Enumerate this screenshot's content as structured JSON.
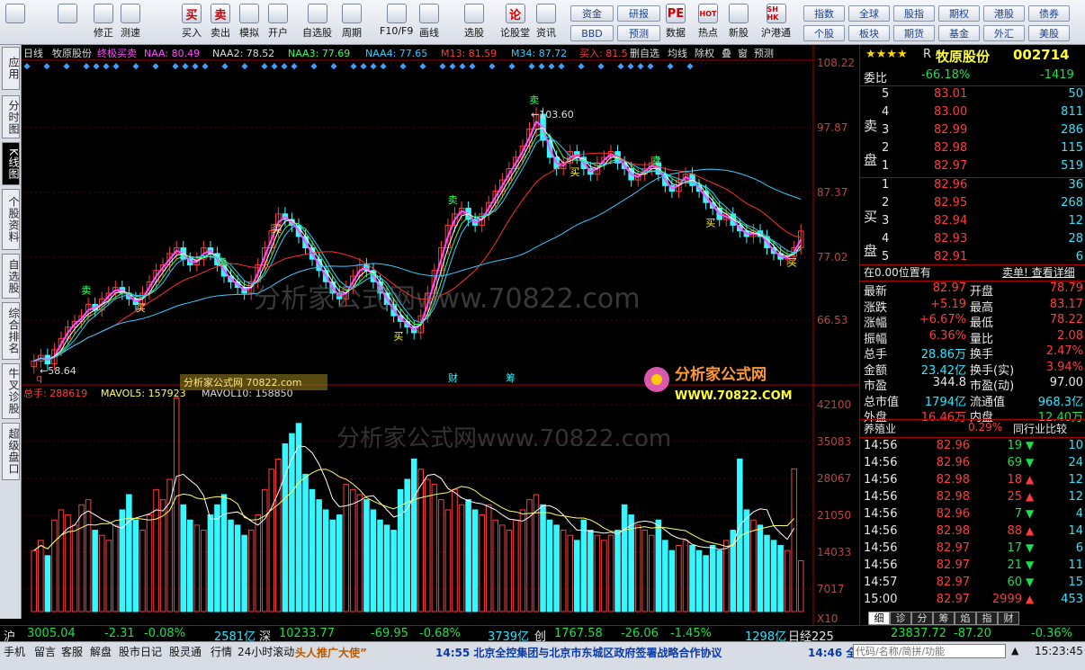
{
  "toolbar": {
    "buttons": [
      {
        "label": "",
        "icon": "app-logo-icon"
      },
      {
        "label": "",
        "icon": "back-arrow-icon"
      },
      {
        "label": "修正",
        "icon": "up-down-icon"
      },
      {
        "label": "测速",
        "icon": "speed-test-icon"
      },
      {
        "label": "买入",
        "icon": "buy-icon",
        "glyph": "买"
      },
      {
        "label": "卖出",
        "icon": "sell-icon",
        "glyph": "卖"
      },
      {
        "label": "模拟",
        "icon": "hammer-icon"
      },
      {
        "label": "开户",
        "icon": "lock-icon"
      },
      {
        "label": "自选股",
        "icon": "star-icon"
      },
      {
        "label": "周期",
        "icon": "clock-icon"
      },
      {
        "label": "F10/F9",
        "icon": "f10-icon"
      },
      {
        "label": "画线",
        "icon": "pen-icon"
      },
      {
        "label": "选股",
        "icon": "select-stock-icon"
      },
      {
        "label": "论股堂",
        "icon": "forum-icon",
        "glyph": "论"
      },
      {
        "label": "资讯",
        "icon": "news-icon"
      },
      {
        "label": "数据",
        "icon": "data-icon",
        "glyph": "PE"
      },
      {
        "label": "热点",
        "icon": "hot-icon",
        "glyph": "HOT"
      },
      {
        "label": "新股",
        "icon": "new-stock-icon"
      },
      {
        "label": "沪港通",
        "icon": "hk-connect-icon",
        "glyph": "SH HK"
      }
    ],
    "grid_buttons": [
      "资金",
      "研报",
      "BBD",
      "预测"
    ],
    "right_buttons": [
      [
        "指数",
        "全球",
        "股指",
        "期权",
        "港股",
        "债券"
      ],
      [
        "个股",
        "板块",
        "期货",
        "基金",
        "外汇",
        "美股"
      ]
    ]
  },
  "left_tabs": [
    "应用",
    "分时图",
    "K线图",
    "个股资料",
    "自选股",
    "综合排名",
    "牛叉诊股",
    "超级盘口"
  ],
  "chart_header": {
    "period": "日线",
    "name": "牧原股份",
    "indicator": "终极买卖",
    "naa": "NAA: 80.49",
    "naa2": "NAA2: 78.52",
    "naa3": "NAA3: 77.69",
    "naa4": "NAA4: 77.65",
    "m13": "M13: 81.59",
    "m34": "M34: 87.72",
    "buyin": "买入: 81.5",
    "tools": [
      "删自选",
      "均线",
      "除权",
      "叠",
      "窗",
      "预测"
    ]
  },
  "price_axis": [
    "108.22",
    "97.87",
    "87.37",
    "77.02",
    "66.53"
  ],
  "volume_axis": [
    "42100",
    "35083",
    "28067",
    "21050",
    "14033",
    "7017",
    "X10"
  ],
  "chart_labels": {
    "high": "103.60",
    "low": "58.64",
    "fin": "财",
    "chou": "筹",
    "q": "q"
  },
  "volume_header": {
    "total": "总手: 288619",
    "mavol5": "MAVOL5: 157923",
    "mavol10": "MAVOL10: 158850"
  },
  "watermark": {
    "text": "分析家公式网www.70822.com",
    "tag": "分析家公式网 70822.com",
    "logo": "分析家公式网",
    "logo_url": "WWW.70822.COM"
  },
  "chart_data": {
    "type": "candlestick",
    "title": "牧原股份 日线",
    "ylim": [
      58.64,
      108.22
    ],
    "closes": [
      60,
      61,
      59.5,
      62,
      64,
      66,
      67,
      68,
      70,
      69,
      71,
      72,
      73,
      72,
      71,
      70,
      72,
      74,
      76,
      77,
      79,
      80,
      78,
      77,
      78,
      80,
      79,
      77,
      75,
      74,
      73,
      72,
      74,
      77,
      80,
      83,
      86,
      85,
      84,
      82,
      80,
      78,
      76,
      74,
      72,
      71,
      73,
      75,
      77,
      76,
      74,
      72,
      70,
      68,
      67,
      66,
      65,
      68,
      72,
      76,
      80,
      84,
      86,
      87,
      85,
      84,
      86,
      88,
      90,
      92,
      94,
      96,
      98,
      101,
      103.6,
      99,
      96,
      94,
      95,
      97,
      96,
      94,
      93,
      95,
      96,
      97,
      95,
      94,
      92,
      93,
      94,
      95,
      93,
      91,
      90,
      92,
      93,
      91,
      90,
      88,
      87,
      85,
      86,
      84,
      83,
      82,
      83,
      82,
      80,
      79,
      78,
      78.5,
      80,
      82.97
    ],
    "volumes": [
      12000,
      14000,
      11000,
      18000,
      20000,
      19000,
      17000,
      21000,
      22000,
      16000,
      15000,
      14000,
      17000,
      20000,
      23000,
      18000,
      16000,
      19000,
      24000,
      22000,
      26000,
      42000,
      21000,
      18000,
      17000,
      16000,
      19000,
      21000,
      23000,
      18000,
      17000,
      15000,
      16000,
      19000,
      24000,
      28000,
      30000,
      33000,
      35000,
      37000,
      27000,
      24000,
      22000,
      20000,
      18000,
      19000,
      25000,
      24000,
      23000,
      22000,
      20000,
      18000,
      17000,
      16000,
      24000,
      26000,
      30000,
      28000,
      26000,
      25000,
      22000,
      20000,
      24000,
      21000,
      22000,
      20000,
      19000,
      21000,
      18000,
      17000,
      16000,
      18000,
      20000,
      22000,
      23000,
      21000,
      18000,
      17000,
      16000,
      15000,
      14000,
      18000,
      16000,
      15000,
      14000,
      15000,
      16000,
      21000,
      19000,
      17000,
      16000,
      15000,
      18000,
      14000,
      12000,
      13000,
      14000,
      13000,
      12000,
      11000,
      13000,
      12000,
      14000,
      16000,
      30000,
      20000,
      18000,
      17000,
      15000,
      14000,
      13000,
      12000,
      28067
    ],
    "ma_series": [
      "NAA",
      "NAA2",
      "NAA3",
      "NAA4",
      "M13",
      "M34"
    ]
  },
  "right_panel": {
    "title": "牧原股份",
    "code": "002714",
    "r_mark": "R",
    "weibi_label": "委比",
    "weibi": "-66.18%",
    "weicha": "-1419",
    "sell_label": "卖盘",
    "buy_label": "买盘",
    "sells": [
      [
        "5",
        "83.01",
        "50"
      ],
      [
        "4",
        "83.00",
        "811"
      ],
      [
        "3",
        "82.99",
        "286"
      ],
      [
        "2",
        "82.98",
        "115"
      ],
      [
        "1",
        "82.97",
        "519"
      ]
    ],
    "buys": [
      [
        "1",
        "82.96",
        "36"
      ],
      [
        "2",
        "82.95",
        "268"
      ],
      [
        "3",
        "82.94",
        "12"
      ],
      [
        "4",
        "82.93",
        "28"
      ],
      [
        "5",
        "82.91",
        "6"
      ]
    ],
    "position_note": "在0.00位置有",
    "detail_links": "卖单! 查看详细",
    "quote_rows": [
      [
        "最新",
        "82.97",
        "开盘",
        "78.79"
      ],
      [
        "涨跌",
        "+5.19",
        "最高",
        "83.17"
      ],
      [
        "涨幅",
        "+6.67%",
        "最低",
        "78.22"
      ],
      [
        "振幅",
        "6.36%",
        "量比",
        "2.08"
      ],
      [
        "总手",
        "28.86万",
        "换手",
        "2.47%"
      ],
      [
        "金额",
        "23.42亿",
        "换手(实)",
        "3.94%"
      ],
      [
        "市盈",
        "344.8",
        "市盈(动)",
        "97.00"
      ],
      [
        "总市值",
        "1794亿",
        "流通值",
        "968.3亿"
      ],
      [
        "外盘",
        "16.46万",
        "内盘",
        "12.40万"
      ]
    ],
    "industry": "养殖业",
    "industry_pct": "0.29%",
    "compare": "同行业比较",
    "ticks": [
      [
        "14:56",
        "82.96",
        "19",
        "down",
        "10"
      ],
      [
        "14:56",
        "82.96",
        "69",
        "down",
        "24"
      ],
      [
        "14:56",
        "82.98",
        "18",
        "up",
        "12"
      ],
      [
        "14:56",
        "82.98",
        "25",
        "up",
        "12"
      ],
      [
        "14:56",
        "82.96",
        "7",
        "down",
        "4"
      ],
      [
        "14:56",
        "82.98",
        "88",
        "up",
        "14"
      ],
      [
        "14:56",
        "82.97",
        "17",
        "down",
        "6"
      ],
      [
        "14:56",
        "82.97",
        "21",
        "down",
        "11"
      ],
      [
        "14:57",
        "82.97",
        "60",
        "down",
        "15"
      ],
      [
        "15:00",
        "82.97",
        "2999",
        "up",
        "453"
      ]
    ],
    "tabs": [
      "细",
      "诊",
      "分",
      "筹",
      "焰",
      "指",
      "财"
    ]
  },
  "statusbar": {
    "sh": "沪",
    "sh_idx": "3005.04",
    "sh_chg": "-2.31",
    "sh_pct": "-0.08%",
    "sh_amt": "2581亿",
    "sz": "深",
    "sz_idx": "10233.77",
    "sz_chg": "-69.95",
    "sz_pct": "-0.68%",
    "sz_amt": "3739亿",
    "cy": "创",
    "cy_idx": "1767.58",
    "cy_chg": "-26.06",
    "cy_pct": "-1.45%",
    "cy_amt": "1298亿",
    "nk": "日经225",
    "nk_idx": "23837.72",
    "nk_chg": "-87.20",
    "nk_pct": "-0.36%"
  },
  "bottombar": {
    "tabs": [
      "手机",
      "留言",
      "客服",
      "解盘",
      "股市日记",
      "股灵通",
      "行情",
      "24小时滚动"
    ],
    "promo": "头人推广大使”",
    "news": "14:55 北京全控集团与北京市东城区政府签署战略合作协议",
    "news2": "14:46 全",
    "search_placeholder": "代码/名称/简拼/功能",
    "time": "15:23:45"
  }
}
